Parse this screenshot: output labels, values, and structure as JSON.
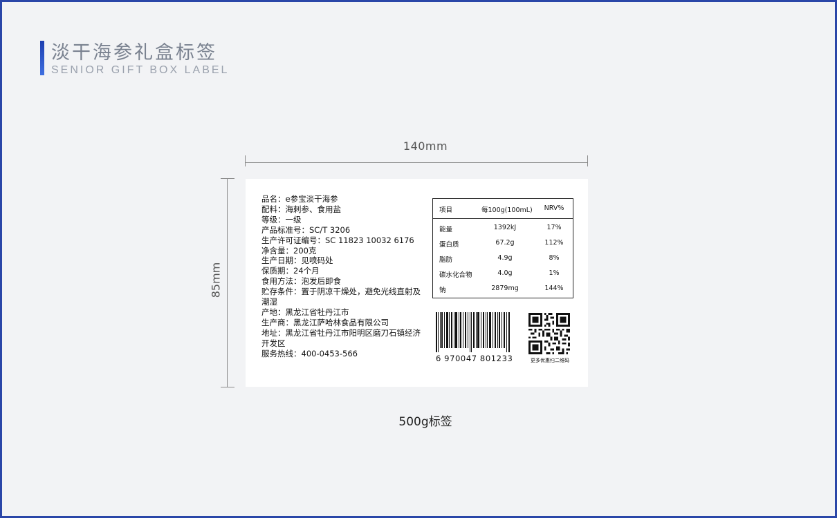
{
  "header": {
    "title_cn": "淡干海参礼盒标签",
    "title_en": "SENIOR GIFT BOX LABEL"
  },
  "dimensions": {
    "width_label": "140mm",
    "height_label": "85mm"
  },
  "label": {
    "info_lines": [
      "品名：e参宝淡干海参",
      "配料：海刺参、食用盐",
      "等级：一级",
      "产品标准号：SC/T 3206",
      "生产许可证编号：SC 11823 10032 6176",
      "净含量：200克",
      "生产日期：见喷码处",
      "保质期：24个月",
      "食用方法：泡发后即食",
      "贮存条件：置于阴凉干燥处，避免光线直射及潮湿",
      "产地：黑龙江省牡丹江市",
      "生产商：黑龙江萨哈林食品有限公司",
      "地址：黑龙江省牡丹江市阳明区磨刀石镇经济开发区",
      "服务热线：400-0453-566"
    ],
    "nutrition": {
      "headers": [
        "项目",
        "每100g(100mL)",
        "NRV%"
      ],
      "rows": [
        [
          "能量",
          "1392kJ",
          "17%"
        ],
        [
          "蛋白质",
          "67.2g",
          "112%"
        ],
        [
          "脂肪",
          "4.9g",
          "8%"
        ],
        [
          "碳水化合物",
          "4.0g",
          "1%"
        ],
        [
          "钠",
          "2879mg",
          "144%"
        ]
      ]
    },
    "barcode_number": "6 970047 801233",
    "qr_caption": "更多优惠扫二维码"
  },
  "caption": "500g标签",
  "colors": {
    "frame": "#2a46a8",
    "accent": "#1d3fb0",
    "background": "#f2f3f5"
  }
}
